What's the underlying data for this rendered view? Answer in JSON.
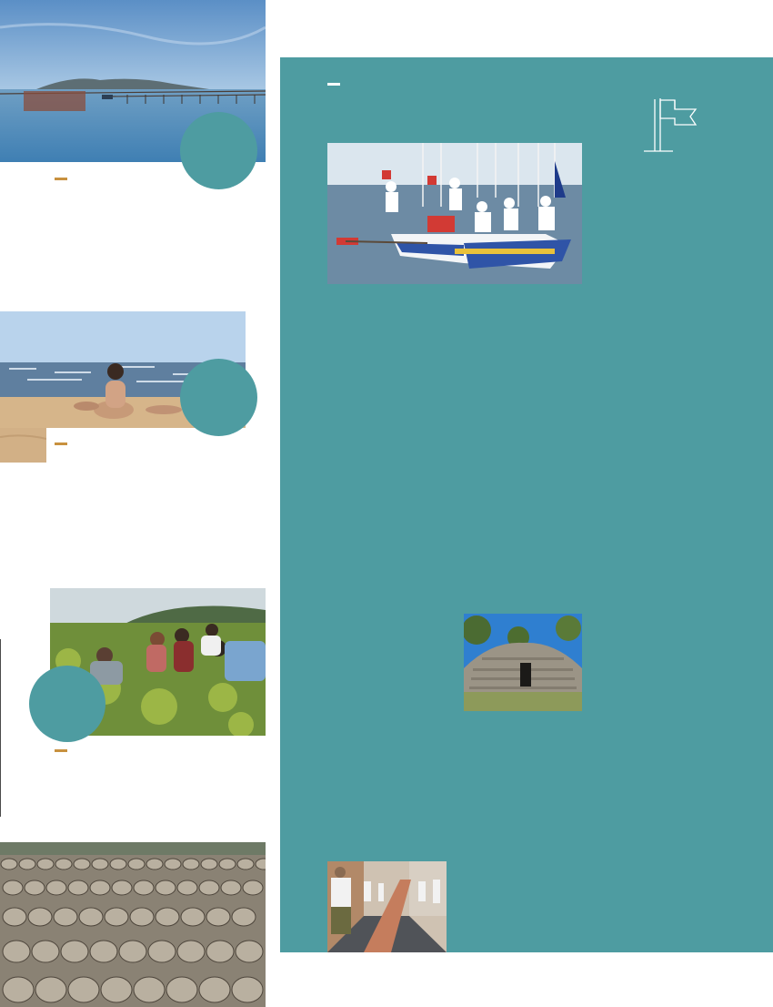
{
  "page": {
    "background": "#ffffff",
    "accent_teal": "#4e9ca1",
    "accent_gold": "#c8913f"
  },
  "icons": {
    "flag": "flag-outline-icon"
  },
  "photos": [
    {
      "subject": "lagoon-oyster-tables"
    },
    {
      "subject": "beach-sunbathers"
    },
    {
      "subject": "vineyard-tasting"
    },
    {
      "subject": "wine-barrels-yard"
    },
    {
      "subject": "jousting-boat"
    },
    {
      "subject": "dry-stone-hut"
    },
    {
      "subject": "street-game"
    }
  ]
}
